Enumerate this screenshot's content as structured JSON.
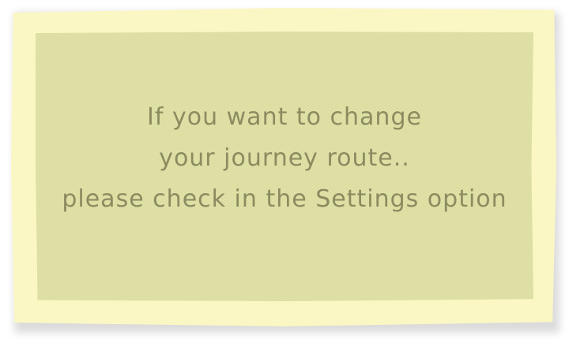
{
  "dialog": {
    "message_lines": [
      "If you want to change",
      "your journey route..",
      "please check in the Settings option"
    ]
  },
  "colors": {
    "paper_border": "#fbf7c4",
    "paper_center": "#dfe1a3",
    "text": "#8c8b60"
  }
}
